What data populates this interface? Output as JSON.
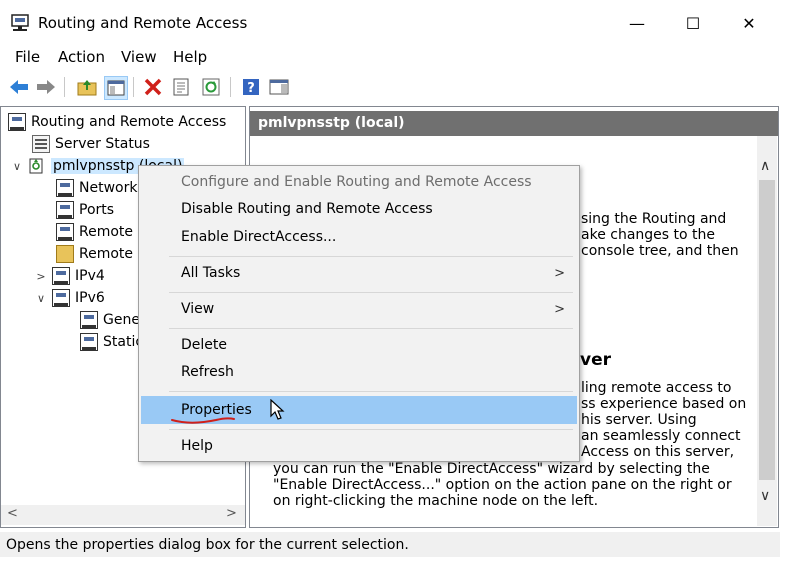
{
  "window": {
    "title": "Routing and Remote Access",
    "minimize": "—",
    "maximize": "☐",
    "close": "✕"
  },
  "menubar": {
    "items": [
      "File",
      "Action",
      "View",
      "Help"
    ]
  },
  "toolbar": {
    "buttons": [
      "back-icon",
      "forward-icon",
      "up-folder-icon",
      "show-hide-tree-icon",
      "delete-icon",
      "properties-icon",
      "refresh-icon",
      "help-icon",
      "console-icon"
    ]
  },
  "tree": {
    "root": "Routing and Remote Access",
    "server_status": "Server Status",
    "server_node": "pmlvpnsstp (local)",
    "children": [
      "Network",
      "Ports",
      "Remote",
      "Remote",
      "IPv4",
      "IPv6",
      "Gene",
      "Static"
    ]
  },
  "right_pane": {
    "header": "pmlvpnsstp (local)",
    "fragments": {
      "line1": "sing the Routing and",
      "line2": "ake changes to the",
      "line3": "console tree, and then",
      "heading_tail": "ver",
      "p2_line1": "ling remote access to",
      "p2_line2": "ss experience based on",
      "p2_line3": "his server. Using",
      "p2_line4": "an seamlessly connect",
      "p2_line5": "Access on this server,",
      "p2_full1": "you can run the \"Enable DirectAccess\" wizard by selecting the",
      "p2_full2": "\"Enable DirectAccess...\" option on the action pane on the right or",
      "p2_full3": "on right-clicking the machine node on the left."
    }
  },
  "context_menu": {
    "items": [
      {
        "label": "Configure and Enable Routing and Remote Access",
        "disabled": true
      },
      {
        "label": "Disable Routing and Remote Access"
      },
      {
        "label": "Enable DirectAccess..."
      },
      {
        "label": "All Tasks",
        "submenu": true
      },
      {
        "label": "View",
        "submenu": true
      },
      {
        "label": "Delete"
      },
      {
        "label": "Refresh"
      },
      {
        "label": "Properties",
        "highlighted": true
      },
      {
        "label": "Help"
      }
    ]
  },
  "statusbar": {
    "text": "Opens the properties dialog box for the current selection."
  },
  "colors": {
    "highlight": "#99c9f5",
    "header_bg": "#707070",
    "tree_selection": "#cce8ff",
    "annotation_red": "#d0201a"
  }
}
